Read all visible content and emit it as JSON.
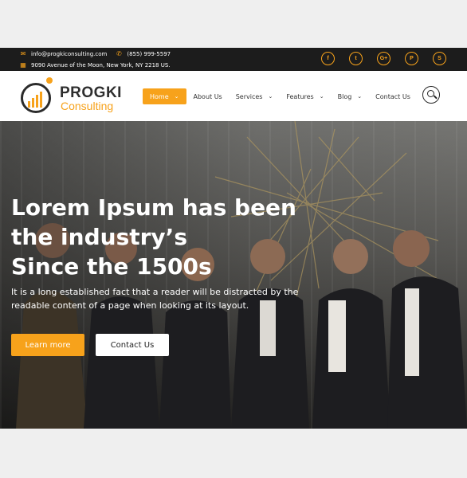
{
  "topbar": {
    "email": "info@progkiconsulting.com",
    "phone": "(855) 999-5597",
    "address": "9090 Avenue of the Moon, New York, NY 2218 US.",
    "socials": [
      {
        "icon": "facebook-icon",
        "glyph": "f"
      },
      {
        "icon": "twitter-icon",
        "glyph": "t"
      },
      {
        "icon": "google-plus-icon",
        "glyph": "G+"
      },
      {
        "icon": "pinterest-icon",
        "glyph": "P"
      },
      {
        "icon": "skype-icon",
        "glyph": "S"
      }
    ]
  },
  "brand": {
    "name": "PROGKI",
    "sub": "Consulting",
    "accent": "#f7a21b"
  },
  "nav": {
    "items": [
      {
        "label": "Home",
        "active": true,
        "dropdown": true
      },
      {
        "label": "About Us",
        "active": false,
        "dropdown": false
      },
      {
        "label": "Services",
        "active": false,
        "dropdown": true
      },
      {
        "label": "Features",
        "active": false,
        "dropdown": true
      },
      {
        "label": "Blog",
        "active": false,
        "dropdown": true
      },
      {
        "label": "Contact Us",
        "active": false,
        "dropdown": false
      }
    ],
    "chevron": "⌄"
  },
  "hero": {
    "title_lines": [
      "Lorem Ipsum has been",
      "the industry’s",
      "Since the 1500s"
    ],
    "description": "It is a long established fact that a reader will be distracted by the readable content of a page when looking at its layout.",
    "primary_button": "Learn more",
    "secondary_button": "Contact Us"
  }
}
